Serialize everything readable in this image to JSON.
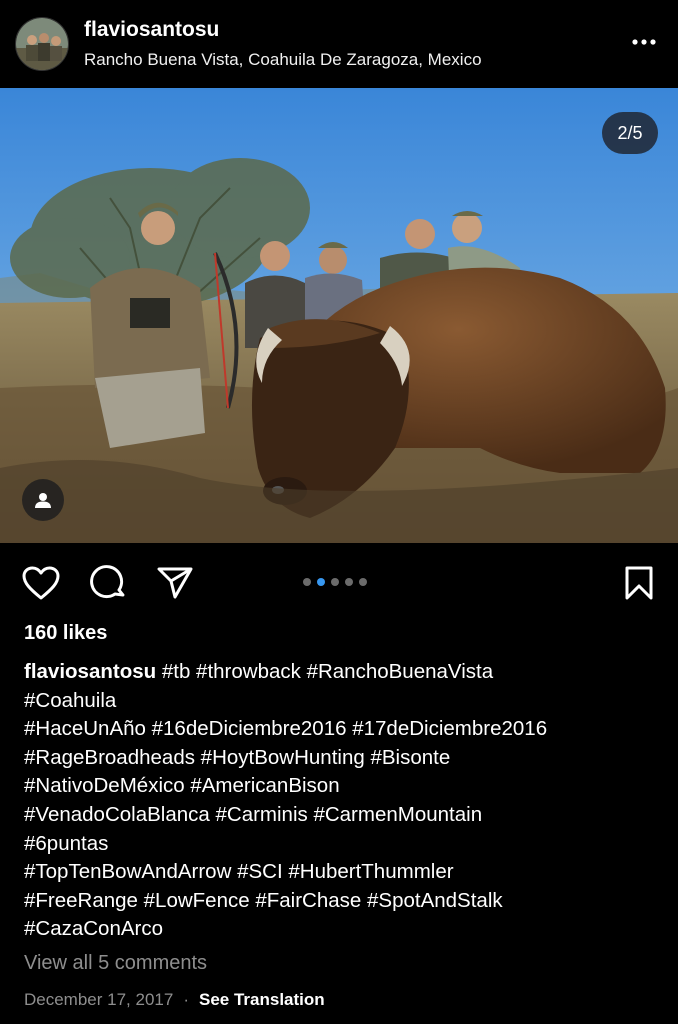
{
  "post": {
    "username": "flaviosantosu",
    "location": "Rancho Buena Vista, Coahuila De Zaragoza, Mexico",
    "carousel_counter": "2/5",
    "carousel_total": 5,
    "carousel_current": 2,
    "likes": "160 likes",
    "caption": {
      "username": "flaviosantosu",
      "lines": [
        "#tb #throwback #RanchoBuenaVista",
        "#Coahuila",
        "#HaceUnAño #16deDiciembre2016 #17deDiciembre2016",
        "#RageBroadheads #HoytBowHunting #Bisonte",
        "#NativoDeMéxico #AmericanBison",
        "#VenadoColaBlanca #Carminis #CarmenMountain",
        "#6puntas",
        "#TopTenBowAndArrow #SCI #HubertThummler",
        "#FreeRange #LowFence #FairChase #SpotAndStalk",
        "#CazaConArco"
      ]
    },
    "view_comments": "View all 5 comments",
    "date": "December 17, 2017",
    "separator": "·",
    "see_translation": "See Translation"
  },
  "icons": {
    "more": "more-options-icon",
    "like": "heart-icon",
    "comment": "comment-icon",
    "share": "send-icon",
    "save": "bookmark-icon",
    "tag": "user-tag-icon"
  },
  "colors": {
    "background": "#000000",
    "active_dot": "#3797f0",
    "muted_text": "#8e8e8e"
  }
}
